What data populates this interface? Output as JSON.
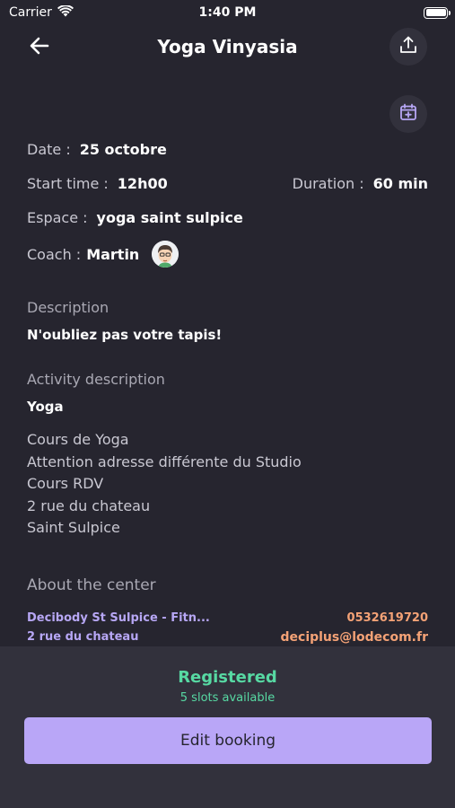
{
  "status_bar": {
    "carrier": "Carrier",
    "time": "1:40 PM"
  },
  "header": {
    "title": "Yoga Vinyasia"
  },
  "details": {
    "date_label": "Date :",
    "date_value": "25 octobre",
    "start_label": "Start time :",
    "start_value": "12h00",
    "duration_label": "Duration :",
    "duration_value": "60 min",
    "space_label": "Espace :",
    "space_value": "yoga saint sulpice",
    "coach_label": "Coach :",
    "coach_value": "Martin"
  },
  "description": {
    "label": "Description",
    "text": "N'oubliez pas votre tapis!"
  },
  "activity": {
    "label": "Activity description",
    "name": "Yoga",
    "lines": [
      "Cours de Yoga",
      "Attention adresse différente du Studio",
      "Cours RDV",
      "2 rue du chateau",
      "Saint Sulpice"
    ]
  },
  "center": {
    "label": "About the center",
    "name": "Decibody St Sulpice - Fitn...",
    "address": "2 rue du chateau",
    "phone": "0532619720",
    "email": "deciplus@lodecom.fr"
  },
  "booking": {
    "status": "Registered",
    "slots": "5 slots available",
    "edit_label": "Edit booking"
  },
  "colors": {
    "background": "#26252f",
    "panel": "#32313c",
    "accent_purple": "#b9a6f7",
    "accent_orange": "#f4a276",
    "success_green": "#57d9a3"
  },
  "icons": {
    "back": "arrow-left-icon",
    "share": "share-upload-icon",
    "calendar": "calendar-add-icon",
    "wifi": "wifi-icon",
    "battery": "battery-icon"
  }
}
